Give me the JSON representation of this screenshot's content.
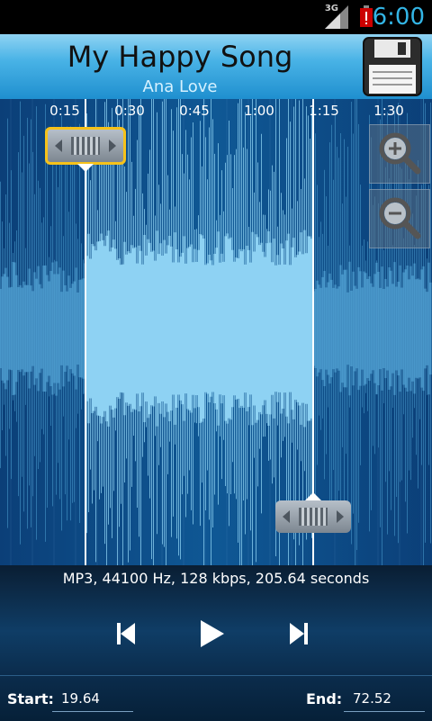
{
  "status_bar": {
    "network": "3G",
    "time": "6:00"
  },
  "song": {
    "title": "My Happy Song",
    "artist": "Ana Love"
  },
  "timeline": {
    "ticks": [
      "0:15",
      "0:30",
      "0:45",
      "1:00",
      "1:15",
      "1:30"
    ]
  },
  "file_info": "MP3, 44100 Hz, 128 kbps, 205.64 seconds",
  "selection": {
    "start_label": "Start:",
    "start_value": "19.64",
    "end_label": "End:",
    "end_value": "72.52"
  },
  "icons": {
    "save": "floppy-disk-icon",
    "zoom_in": "zoom-in-icon",
    "zoom_out": "zoom-out-icon",
    "previous": "skip-previous-icon",
    "play": "play-icon",
    "next": "skip-next-icon"
  },
  "colors": {
    "accent": "#33b5e5",
    "selection": "#8ed2f3",
    "start_handle_border": "#f6c21a"
  }
}
